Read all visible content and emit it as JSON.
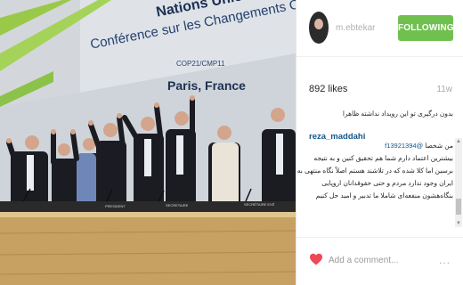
{
  "photo": {
    "banner_line1": "Nations Unies",
    "banner_line2": "Conférence sur les Changements Climatiques",
    "banner_line3": "COP21/CMP11",
    "banner_line4": "Paris, France",
    "desk_labels": [
      "PRESIDENT",
      "SECRETAIRE",
      "SECRÉTAIRE EXÉ"
    ]
  },
  "header": {
    "username": "m.ebtekar",
    "follow_label": "FOLLOWING"
  },
  "post": {
    "likes": "892 likes",
    "time_ago": "11w",
    "comment": {
      "line1": "بدون درگیری تو این رویداد نداشته ظاهرا",
      "user": "reza_maddahi",
      "line2_mention": "@f13921394",
      "line2_text": "من شخصا",
      "line3": "بیشترین اعتماد دارم شما هم تحقیق کنین و به نتیجه",
      "line4": "برسین اما کلا شده که در تلاشند هستم اصلاً نگاه منتهی به",
      "line5": "ایران وجود ندارد مردم و حتی حقوقدانان اروپایی",
      "line6": "بنگاه‌هشون منفعه‌ای شاملا ما تدبیر و امید حل کنیم"
    }
  },
  "footer": {
    "add_comment_placeholder": "Add a comment...",
    "more_label": "..."
  },
  "colors": {
    "follow_green": "#70c050",
    "link_blue": "#125688",
    "heart_red": "#ed4956"
  },
  "icons": [
    "heart-icon",
    "more-options-icon",
    "scroll-up-icon",
    "scroll-down-icon"
  ]
}
